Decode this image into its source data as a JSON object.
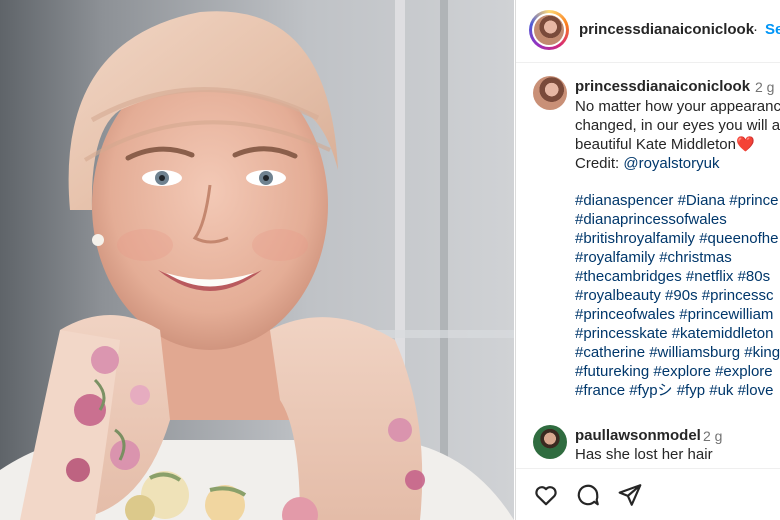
{
  "post": {
    "username": "princessdianaiconiclook",
    "separator": "·",
    "follow_label": "Se"
  },
  "caption": {
    "username": "princessdianaiconiclook",
    "time": "2 g",
    "lines": [
      "No matter how your appearanc",
      "changed, in our eyes you will a",
      "beautiful Kate Middleton❤️"
    ],
    "credit_prefix": "Credit: ",
    "credit_handle": "@royalstoryuk",
    "hashtag_lines": [
      "#dianaspencer #Diana #prince",
      "#dianaprincessofwales",
      "#britishroyalfamily #queenofhe",
      "#royalfamily #christmas",
      "#thecambridges #netflix #80s",
      "#royalbeauty #90s #princessc",
      "#princeofwales #princewilliam",
      "#princesskate #katemiddleton",
      "#catherine #williamsburg #king",
      "#futureking #explore #explore",
      "#france #fypシ #fyp #uk #love"
    ]
  },
  "comment": {
    "username": "paullawsonmodel",
    "time": "2 g",
    "text": "Has she lost her hair"
  },
  "actions": {
    "like_icon": "heart-icon",
    "comment_icon": "comment-icon",
    "share_icon": "share-icon"
  }
}
